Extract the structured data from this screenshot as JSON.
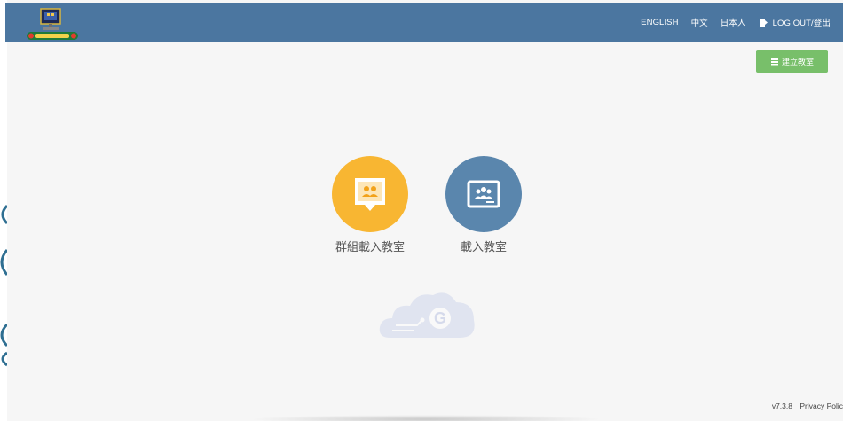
{
  "header": {
    "logo_icon": "classroom-go-logo",
    "nav": {
      "english": "ENGLISH",
      "chinese": "中文",
      "japanese": "日本人",
      "logout": "LOG OUT/登出"
    },
    "logout_icon": "logout-door-icon"
  },
  "actions": {
    "create_classroom": "建立教室",
    "create_icon": "classroom-icon"
  },
  "tiles": [
    {
      "label": "群組載入教室",
      "icon": "group-classroom-icon",
      "color": "#f8b632"
    },
    {
      "label": "載入教室",
      "icon": "google-classroom-icon",
      "color": "#5a86ad"
    }
  ],
  "watermark_icon": "cloud-g-logo",
  "footer": {
    "version": "v7.3.8",
    "privacy": "Privacy Polic"
  },
  "colors": {
    "header_bg": "#4b76a0",
    "create_button": "#78bf6a",
    "page_bg": "#f6f6f6"
  }
}
